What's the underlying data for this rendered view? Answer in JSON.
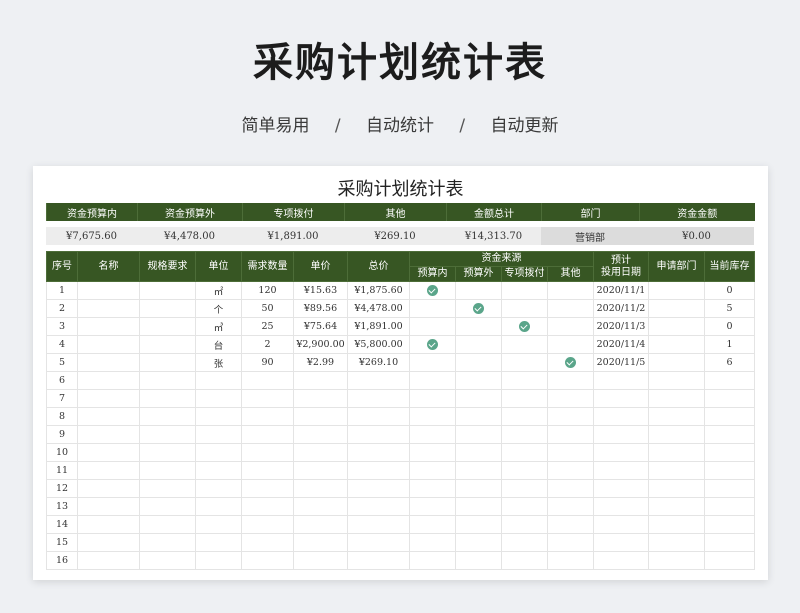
{
  "hero": {
    "title": "采购计划统计表",
    "tags": [
      "简单易用",
      "自动统计",
      "自动更新"
    ],
    "separator": "/"
  },
  "sheet": {
    "title": "采购计划统计表",
    "summary_headers": [
      "资金预算内",
      "资金预算外",
      "专项拨付",
      "其他",
      "金额总计",
      "部门",
      "资金金额"
    ],
    "summary_values": [
      "¥7,675.60",
      "¥4,478.00",
      "¥1,891.00",
      "¥269.10",
      "¥14,313.70",
      "营销部",
      "¥0.00"
    ],
    "columns": {
      "seq": "序号",
      "name": "名称",
      "spec": "规格要求",
      "unit": "单位",
      "qty": "需求数量",
      "price": "单价",
      "total": "总价",
      "fund_source": "资金来源",
      "fund_in": "预算内",
      "fund_out": "预算外",
      "fund_special": "专项拨付",
      "fund_other": "其他",
      "date_line1": "预计",
      "date_line2": "投用日期",
      "dept": "申请部门",
      "stock": "当前库存"
    },
    "rows": [
      {
        "seq": "1",
        "name": "",
        "spec": "",
        "unit": "㎡",
        "qty": "120",
        "price": "¥15.63",
        "total": "¥1,875.60",
        "fund": "in",
        "date": "2020/11/1",
        "dept": "",
        "stock": "0"
      },
      {
        "seq": "2",
        "name": "",
        "spec": "",
        "unit": "个",
        "qty": "50",
        "price": "¥89.56",
        "total": "¥4,478.00",
        "fund": "out",
        "date": "2020/11/2",
        "dept": "",
        "stock": "5"
      },
      {
        "seq": "3",
        "name": "",
        "spec": "",
        "unit": "㎥",
        "qty": "25",
        "price": "¥75.64",
        "total": "¥1,891.00",
        "fund": "special",
        "date": "2020/11/3",
        "dept": "",
        "stock": "0"
      },
      {
        "seq": "4",
        "name": "",
        "spec": "",
        "unit": "台",
        "qty": "2",
        "price": "¥2,900.00",
        "total": "¥5,800.00",
        "fund": "in",
        "date": "2020/11/4",
        "dept": "",
        "stock": "1"
      },
      {
        "seq": "5",
        "name": "",
        "spec": "",
        "unit": "张",
        "qty": "90",
        "price": "¥2.99",
        "total": "¥269.10",
        "fund": "other",
        "date": "2020/11/5",
        "dept": "",
        "stock": "6"
      },
      {
        "seq": "6"
      },
      {
        "seq": "7"
      },
      {
        "seq": "8"
      },
      {
        "seq": "9"
      },
      {
        "seq": "10"
      },
      {
        "seq": "11"
      },
      {
        "seq": "12"
      },
      {
        "seq": "13"
      },
      {
        "seq": "14"
      },
      {
        "seq": "15"
      },
      {
        "seq": "16"
      }
    ]
  },
  "colors": {
    "header_green": "#375623",
    "check_green": "#5aa58a",
    "summary_gray": "#ededed"
  }
}
